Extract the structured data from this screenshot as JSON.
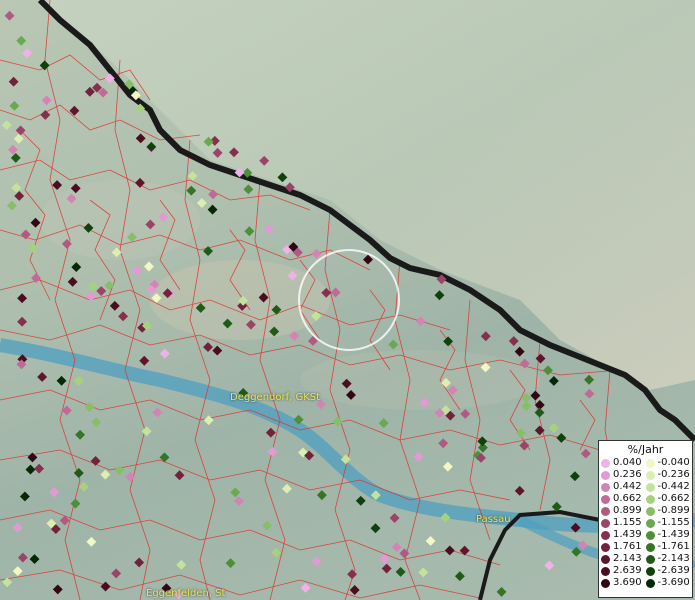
{
  "map": {
    "places": [
      {
        "name": "Deggendorf, GKSt",
        "id": "deggendorf"
      },
      {
        "name": "Passau",
        "id": "passau"
      },
      {
        "name": "Eggenfelden, St",
        "id": "eggenfelden"
      }
    ]
  },
  "legend": {
    "unit": "%/Jahr",
    "positive": [
      {
        "label": "0.040",
        "color": "#f0b0e8"
      },
      {
        "label": "0.236",
        "color": "#e39ad4"
      },
      {
        "label": "0.442",
        "color": "#d484b4"
      },
      {
        "label": "0.662",
        "color": "#c06a98"
      },
      {
        "label": "0.899",
        "color": "#b05a82"
      },
      {
        "label": "1.155",
        "color": "#9a4468"
      },
      {
        "label": "1.439",
        "color": "#86304e"
      },
      {
        "label": "1.761",
        "color": "#72223c"
      },
      {
        "label": "2.143",
        "color": "#5e162c"
      },
      {
        "label": "2.639",
        "color": "#4a0e20"
      },
      {
        "label": "3.690",
        "color": "#340614"
      }
    ],
    "negative": [
      {
        "label": "-0.040",
        "color": "#f3f7c4"
      },
      {
        "label": "-0.236",
        "color": "#dcefb0"
      },
      {
        "label": "-0.442",
        "color": "#c4e39a"
      },
      {
        "label": "-0.662",
        "color": "#a6d27e"
      },
      {
        "label": "-0.899",
        "color": "#88bf66"
      },
      {
        "label": "-1.155",
        "color": "#6aa94e"
      },
      {
        "label": "-1.439",
        "color": "#4e9038"
      },
      {
        "label": "-1.761",
        "color": "#357526"
      },
      {
        "label": "-2.143",
        "color": "#1f5a16"
      },
      {
        "label": "-2.639",
        "color": "#10400c"
      },
      {
        "label": "-3.690",
        "color": "#062806"
      }
    ]
  }
}
